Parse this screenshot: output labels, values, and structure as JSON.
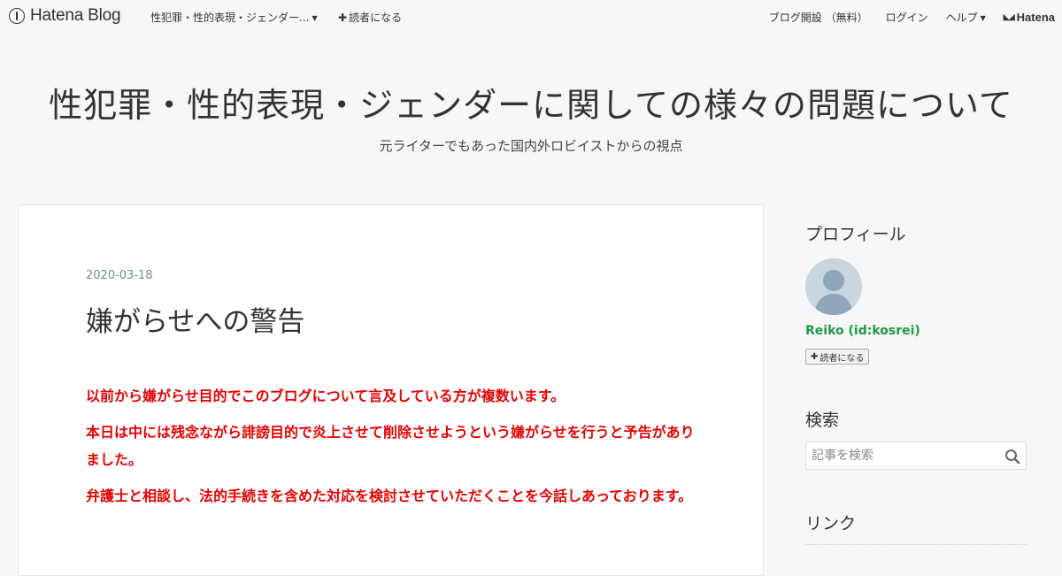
{
  "header": {
    "brand": "Hatena Blog",
    "blog_switch": "性犯罪・性的表現・ジェンダー...",
    "subscribe": "読者になる",
    "links": [
      "ブログ開設 （無料）",
      "ログイン",
      "ヘルプ"
    ],
    "hatena": "Hatena"
  },
  "blog": {
    "title": "性犯罪・性的表現・ジェンダーに関しての様々の問題について",
    "description": "元ライターでもあった国内外ロビイストからの視点"
  },
  "entry": {
    "date": "2020-03-18",
    "title": "嫌がらせへの警告",
    "paragraphs": [
      "以前から嫌がらせ目的でこのブログについて言及している方が複数います。",
      "本日は中には残念ながら誹謗目的で炎上させて削除させようという嫌がらせを行うと予告がありました。",
      "弁護士と相談し、法的手続きを含めた対応を検討させていただくことを今話しあっております。"
    ],
    "text_color": "#e60000"
  },
  "sidebar": {
    "profile_heading": "プロフィール",
    "profile_id": "Reiko (id:kosrei)",
    "subscribe_button": "読者になる",
    "search_heading": "検索",
    "search_placeholder": "記事を検索",
    "link_heading": "リンク",
    "id_color": "#1f9944"
  }
}
